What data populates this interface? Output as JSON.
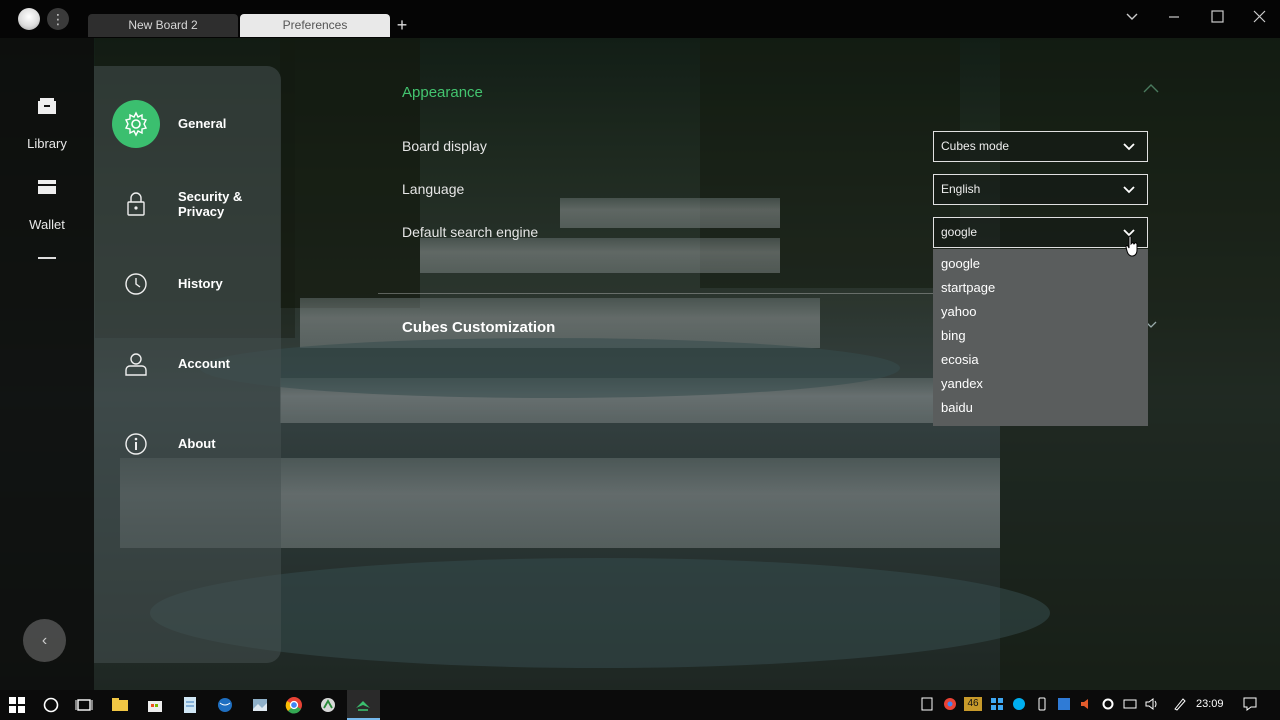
{
  "titlebar": {
    "tabs": [
      {
        "label": "New Board 2"
      },
      {
        "label": "Preferences"
      }
    ],
    "add_tab": "+"
  },
  "leftbar": {
    "items": [
      {
        "label": "Library",
        "icon": "library-icon"
      },
      {
        "label": "Wallet",
        "icon": "wallet-icon"
      }
    ],
    "back": "‹"
  },
  "settings_nav": {
    "items": [
      {
        "label": "General",
        "icon": "gear-icon",
        "active": true
      },
      {
        "label": "Security &",
        "label2": "Privacy",
        "icon": "lock-icon"
      },
      {
        "label": "History",
        "icon": "clock-icon"
      },
      {
        "label": "Account",
        "icon": "user-icon"
      },
      {
        "label": "About",
        "icon": "info-icon"
      }
    ]
  },
  "appearance": {
    "title": "Appearance",
    "rows": [
      {
        "label": "Board display",
        "value": "Cubes mode"
      },
      {
        "label": "Language",
        "value": "English"
      },
      {
        "label": "Default search engine",
        "value": "google"
      }
    ]
  },
  "search_dropdown": {
    "options": [
      "google",
      "startpage",
      "yahoo",
      "bing",
      "ecosia",
      "yandex",
      "baidu"
    ]
  },
  "cubes": {
    "title": "Cubes Customization"
  },
  "taskbar": {
    "clock": "23:09",
    "tray_badge": "46"
  },
  "colors": {
    "accent": "#3bbf6f",
    "section_title": "#43c46f"
  }
}
